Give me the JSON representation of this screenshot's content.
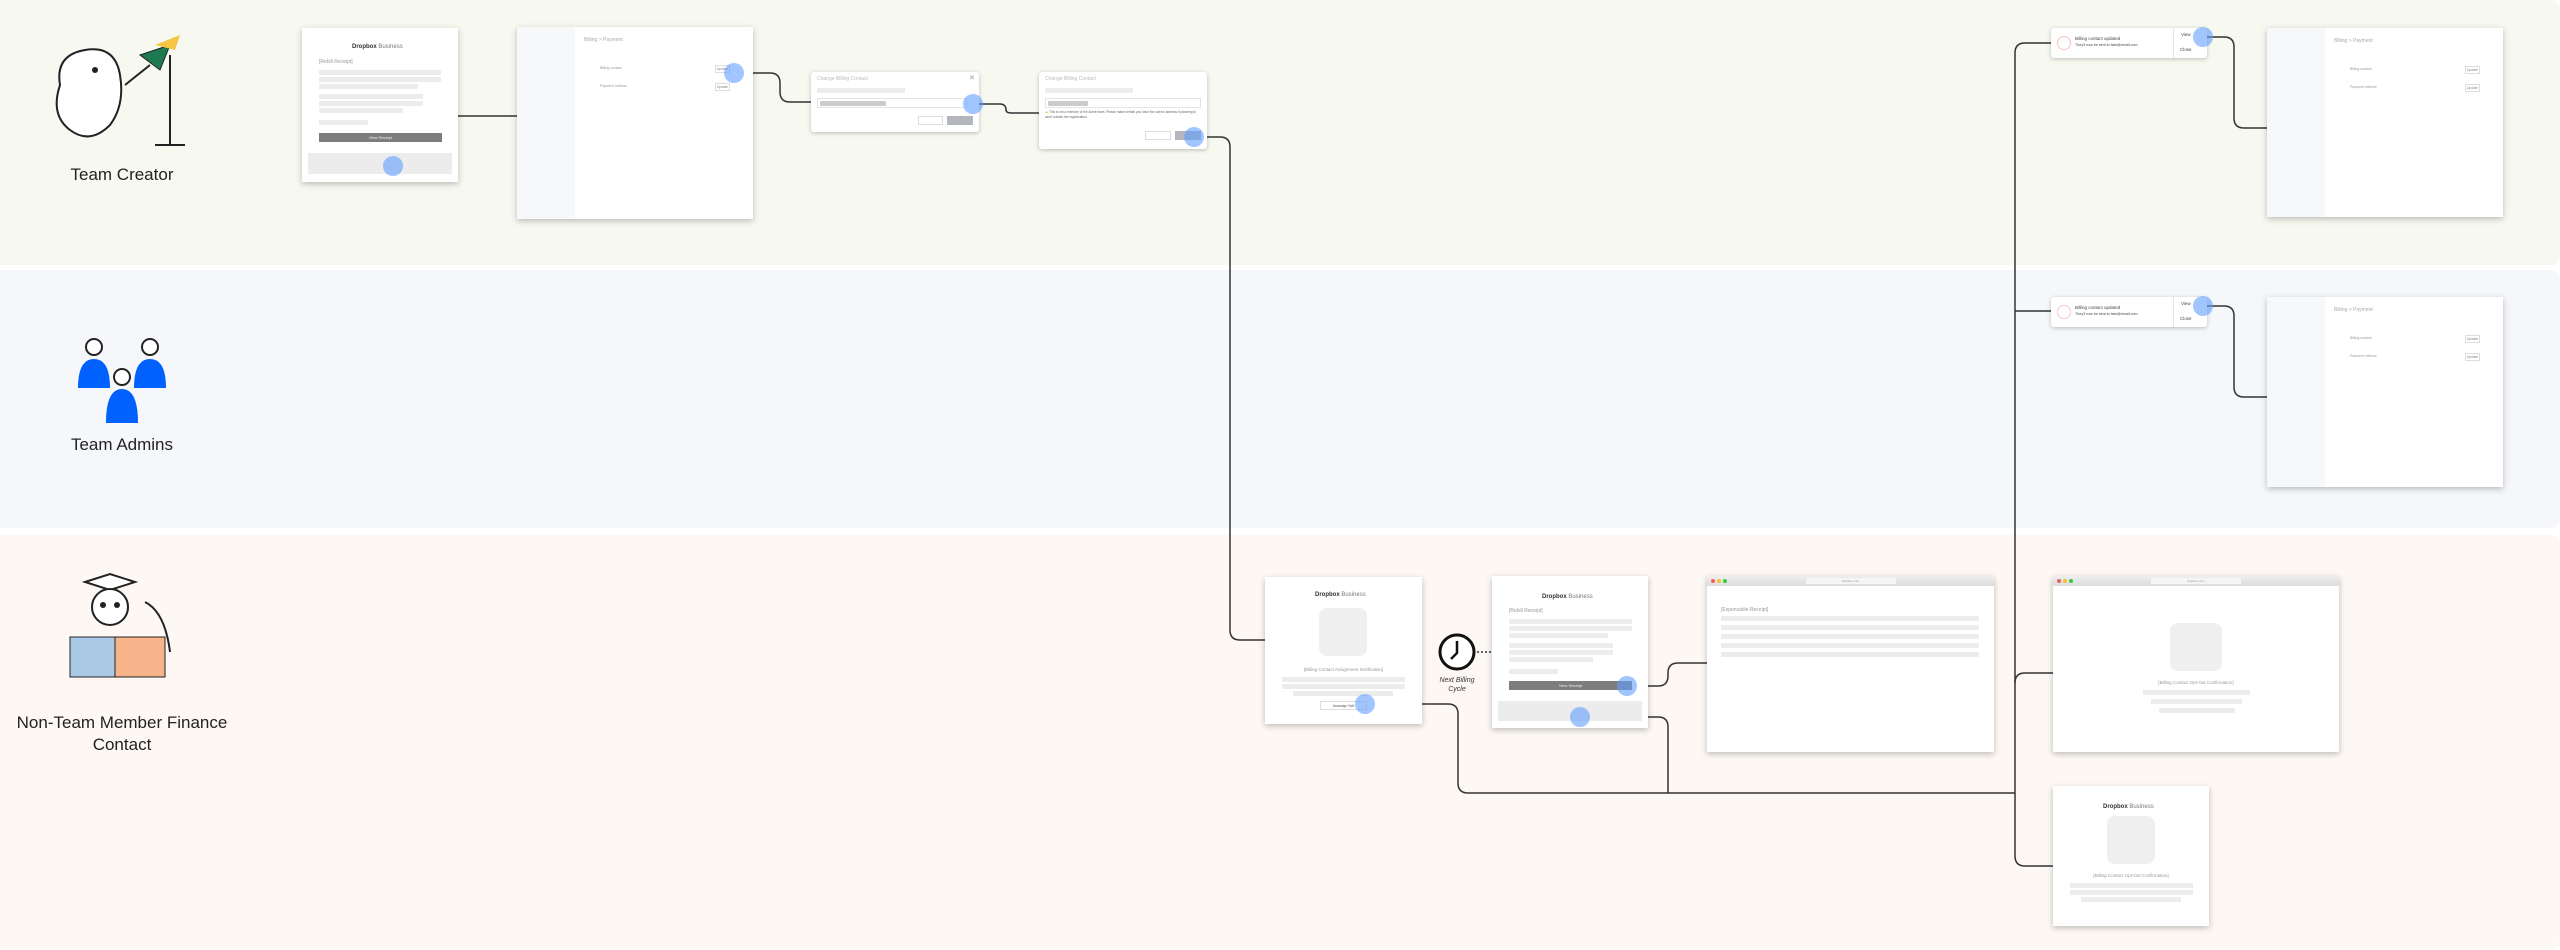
{
  "personas": [
    {
      "label": "Team Creator"
    },
    {
      "label": "Team Admins"
    },
    {
      "label": "Non-Team Member Finance Contact"
    }
  ],
  "colors": {
    "creator_band": "#f7f9f1",
    "admins_band": "#f5f7fa",
    "finance_band": "#fdf8f4",
    "click": "#609eff",
    "admin_figure": "#0061fe"
  },
  "email": {
    "logo": "Dropbox",
    "logo_suffix": "Business",
    "rebill_title": "[Rebill Receipt]",
    "view_receipt": "View Receipt",
    "assign_title": "[Billing Contact Assignment Notification]",
    "unassign": "Unassign Self",
    "optout_title": "[Billing Contact Opt-Out Confirmation]"
  },
  "billing_page": {
    "breadcrumb": "Billing > Payment",
    "billing_contact": "Billing contact",
    "payment_method": "Payment method",
    "update": "Update"
  },
  "dialog": {
    "title": "Change Billing Contact",
    "warning": "This is not a member of the Acme team. Please make certain you have the correct address if planning to send outside the organization."
  },
  "toast": {
    "title": "Billing contact updated",
    "message": "They'll now be sent to fake@email.com",
    "view": "View",
    "close": "Close"
  },
  "timer": {
    "label": "Next Billing Cycle"
  },
  "browser": {
    "url": "dropbox.com",
    "expensable_title": "[Expensable Receipt]",
    "optout_title": "[Billing Contact Opt-Out Confirmation]"
  }
}
